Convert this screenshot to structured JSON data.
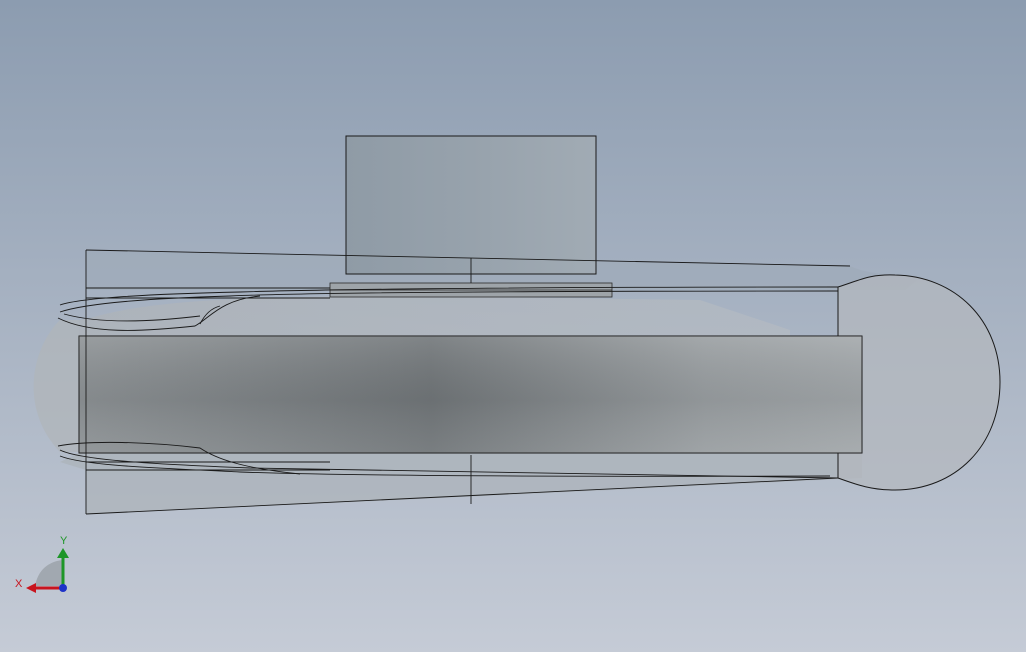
{
  "viewport": {
    "background_top": "#8c9cb0",
    "background_bottom": "#c5cbd6"
  },
  "part": {
    "edge_color": "#1a1a1a",
    "face_light": "#a7acaf",
    "face_dark": "#75797c",
    "ghost_fill": "#b4b9bd"
  },
  "triad": {
    "x_label": "X",
    "y_label": "Y",
    "x_color": "#c8141e",
    "y_color": "#1e9628",
    "z_color": "#1e32c8"
  }
}
